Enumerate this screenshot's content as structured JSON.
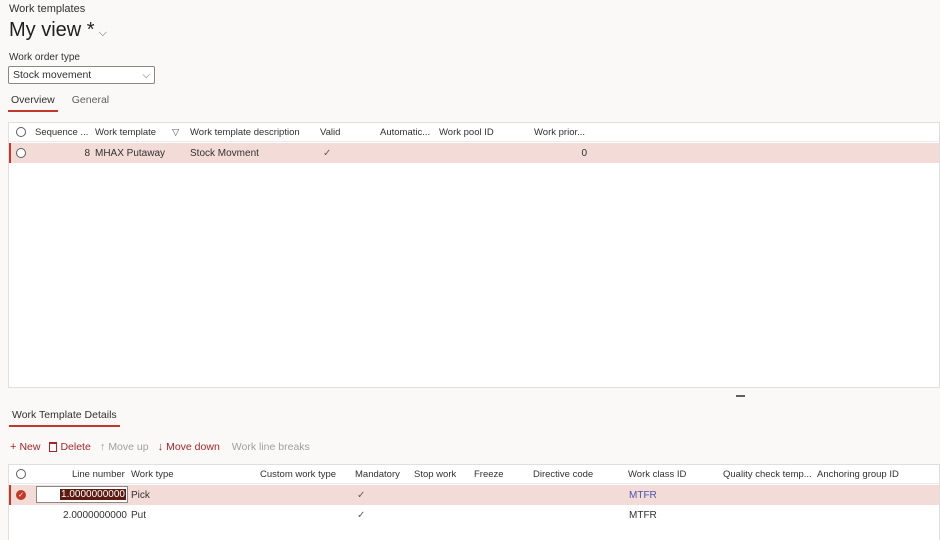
{
  "header": {
    "breadcrumb": "Work templates",
    "view_title": "My view *",
    "view_chevron": "⌵"
  },
  "filter": {
    "label": "Work order type",
    "value": "Stock movement",
    "chevron": "⌵"
  },
  "tabs": [
    {
      "label": "Overview",
      "active": true
    },
    {
      "label": "General",
      "active": false
    }
  ],
  "templates_grid": {
    "columns": [
      "Sequence ...",
      "Work template",
      "Work template description",
      "Valid",
      "Automatic...",
      "Work pool ID",
      "Work prior..."
    ],
    "filter_icon": "▽",
    "rows": [
      {
        "sequence": "8",
        "work_template": "MHAX Putaway",
        "description": "Stock Movment",
        "valid": "✓",
        "automatic": "",
        "work_pool_id": "",
        "work_priority": "0",
        "selected": true
      }
    ]
  },
  "details": {
    "tab_label": "Work Template Details",
    "toolbar": {
      "new": {
        "icon": "+",
        "label": "New"
      },
      "delete": {
        "icon": "🗑",
        "label": "Delete"
      },
      "move_up": {
        "icon": "↑",
        "label": "Move up"
      },
      "move_down": {
        "icon": "↓",
        "label": "Move down"
      },
      "work_line_breaks": {
        "label": "Work line breaks"
      }
    },
    "columns": [
      "Line number",
      "Work type",
      "Custom work type",
      "Mandatory",
      "Stop work",
      "Freeze",
      "Directive code",
      "Work class ID",
      "Quality check temp...",
      "Anchoring group ID"
    ],
    "rows": [
      {
        "line_number": "1.0000000000",
        "work_type": "Pick",
        "custom_work_type": "",
        "mandatory": "✓",
        "stop_work": "",
        "freeze": "",
        "directive_code": "",
        "work_class_id": "MTFR",
        "quality_check": "",
        "anchoring_group": "",
        "selected": true
      },
      {
        "line_number": "2.0000000000",
        "work_type": "Put",
        "custom_work_type": "",
        "mandatory": "✓",
        "stop_work": "",
        "freeze": "",
        "directive_code": "",
        "work_class_id": "MTFR",
        "quality_check": "",
        "anchoring_group": "",
        "selected": false
      }
    ]
  },
  "colors": {
    "accent": "#c0392b",
    "selected_row": "#f3dcd8",
    "link": "#4f52b2"
  }
}
